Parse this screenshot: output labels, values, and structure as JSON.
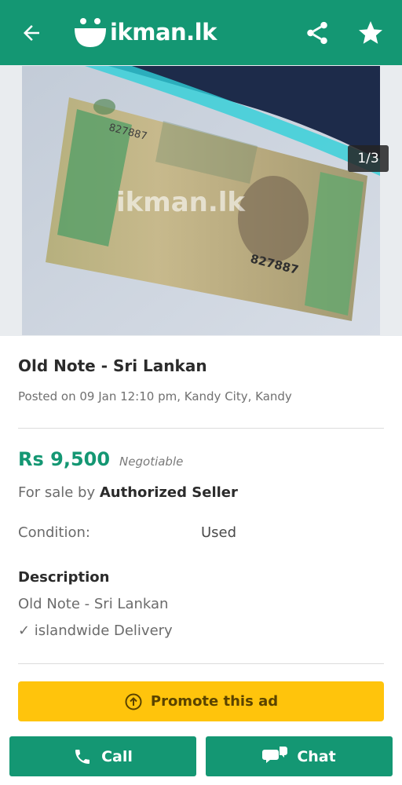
{
  "header": {
    "brand": "ikman.lk",
    "back_icon": "arrow-left-icon",
    "share_icon": "share-icon",
    "favorite_icon": "star-icon",
    "bg_color": "#149773"
  },
  "gallery": {
    "counter": "1/3",
    "watermark": "ikman.lk",
    "note_serial": "827887"
  },
  "listing": {
    "title": "Old Note - Sri Lankan",
    "posted": "Posted on 09 Jan 12:10 pm, Kandy City, Kandy",
    "price": "Rs 9,500",
    "negotiable": "Negotiable",
    "for_sale_prefix": "For sale by ",
    "seller": "Authorized Seller",
    "condition_label": "Condition:",
    "condition_value": "Used",
    "description_heading": "Description",
    "description_lines": [
      "Old Note - Sri Lankan",
      "✓ islandwide Delivery"
    ]
  },
  "actions": {
    "promote_label": "Promote this ad",
    "call_label": "Call",
    "chat_label": "Chat",
    "promote_color": "#ffc40c",
    "primary_color": "#149773"
  }
}
